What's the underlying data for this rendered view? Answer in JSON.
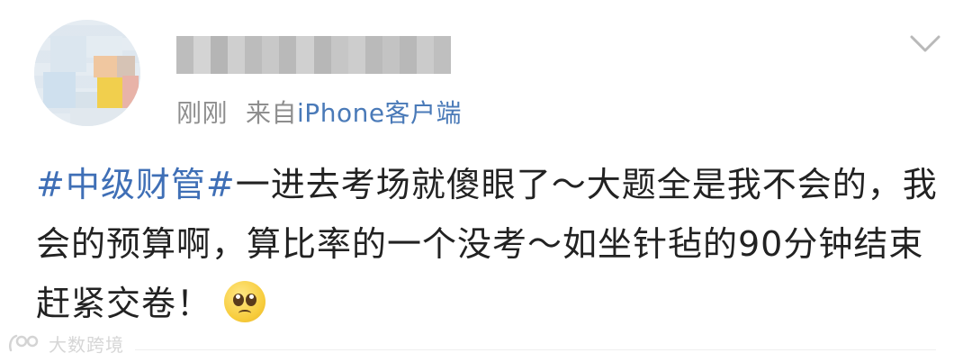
{
  "post": {
    "author": {
      "name": "",
      "avatar": "avatar-icon"
    },
    "meta": {
      "time": "刚刚",
      "source_prefix": "来自",
      "client": "iPhone客户端"
    },
    "menu_icon": "chevron-down-icon",
    "content": {
      "hashtag": "#中级财管#",
      "text": "一进去考场就傻眼了～大题全是我不会的，我会的预算啊，算比率的一个没考～如坐针毡的90分钟结束赶紧交卷！",
      "emoji": "pleading-face-icon"
    }
  },
  "watermark": {
    "text": "大数跨境",
    "icon": "brand-logo-icon"
  },
  "colors": {
    "link": "#3f6fb6",
    "client": "#4a7ab8",
    "meta": "#8e8e8e",
    "text": "#222222"
  }
}
